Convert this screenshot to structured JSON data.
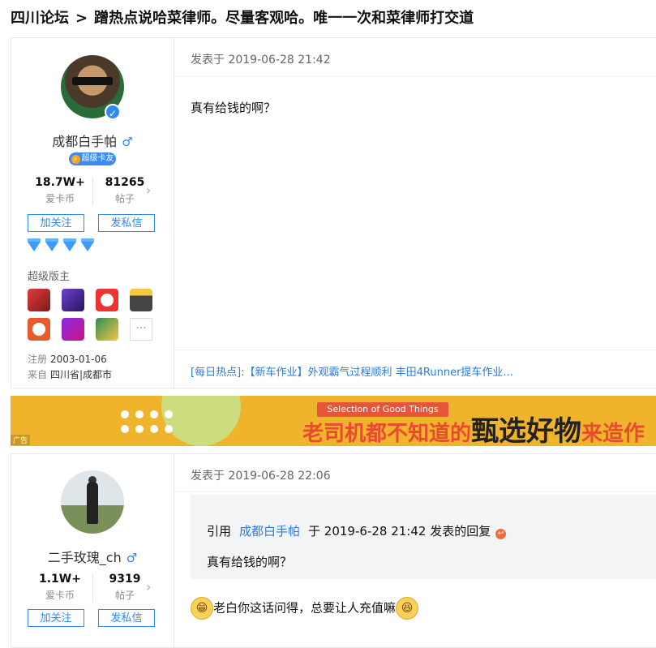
{
  "breadcrumb": {
    "forum": "四川论坛",
    "separator": ">",
    "thread_title": "蹭热点说哈菜律师。尽量客观哈。唯一一次和菜律师打交道"
  },
  "posts": [
    {
      "username": "成都白手帕",
      "gender": "♂",
      "badge": "超级卡友",
      "stats": [
        {
          "value": "18.7W+",
          "label": "爱卡币"
        },
        {
          "value": "81265",
          "label": "帖子"
        }
      ],
      "follow_label": "加关注",
      "message_label": "发私信",
      "role": "超级版主",
      "register_label": "注册",
      "register_date": "2003-01-06",
      "from_label": "来自",
      "from_value": "四川省|成都市",
      "posted_at": "发表于 2019-06-28 21:42",
      "content": "真有给钱的啊？",
      "hot_link": "[每日热点]:【新车作业】外观霸气过程顺利 丰田4Runner提车作业..."
    },
    {
      "username": "二手玫瑰_ch",
      "gender": "♂",
      "stats": [
        {
          "value": "1.1W+",
          "label": "爱卡币"
        },
        {
          "value": "9319",
          "label": "帖子"
        }
      ],
      "follow_label": "加关注",
      "message_label": "发私信",
      "posted_at": "发表于 2019-06-28 22:06",
      "quote": {
        "prefix": "引用",
        "author": "成都白手帕",
        "suffix": "于 2019-6-28 21:42 发表的回复",
        "text": "真有给钱的啊？"
      },
      "content": "老白你这话问得，总要让人充值嘛"
    }
  ],
  "ad": {
    "tag": "广告",
    "english": "Selection of Good Things",
    "slogan_pre": "老司机都不知道的",
    "slogan_big": "甄选好物",
    "slogan_post": "来造作"
  },
  "colors": {
    "link": "#2e7bd6",
    "accent": "#2e89f0",
    "ad_bg": "#f0b42c"
  }
}
